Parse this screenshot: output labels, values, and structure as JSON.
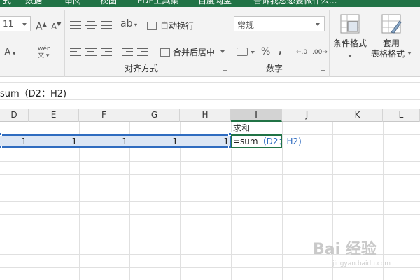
{
  "ribbon": {
    "tabs": [
      "式",
      "数据",
      "审阅",
      "视图",
      "PDF工具集",
      "百度网盘",
      "告诉我您想要做什么..."
    ],
    "font_size": "11",
    "phonetic_glyph": "wén",
    "wrap_text": "自动换行",
    "merge_center": "合并后居中",
    "number_format": "常规",
    "percent": "%",
    "comma": ",",
    "align_group": "对齐方式",
    "number_group": "数字",
    "conditional_format": "条件格式",
    "format_as_table_1": "套用",
    "format_as_table_2": "表格格式"
  },
  "formula_bar": {
    "content": "sum（D2：H2)"
  },
  "columns": [
    "D",
    "E",
    "F",
    "G",
    "H",
    "I",
    "J",
    "K",
    "L"
  ],
  "cells": {
    "i1": "求和",
    "d2": "1",
    "e2": "1",
    "f2": "1",
    "g2": "1",
    "h2": "1",
    "i2_prefix": "=sum",
    "i2_args": "（D2：H2)"
  },
  "watermark": {
    "main": "Bai 经验",
    "sub": "jingyan.baidu.com"
  },
  "colors": {
    "excel_green": "#217346",
    "selection_blue": "#2f6cc0",
    "formula_ref_blue": "#2f6cc0"
  }
}
